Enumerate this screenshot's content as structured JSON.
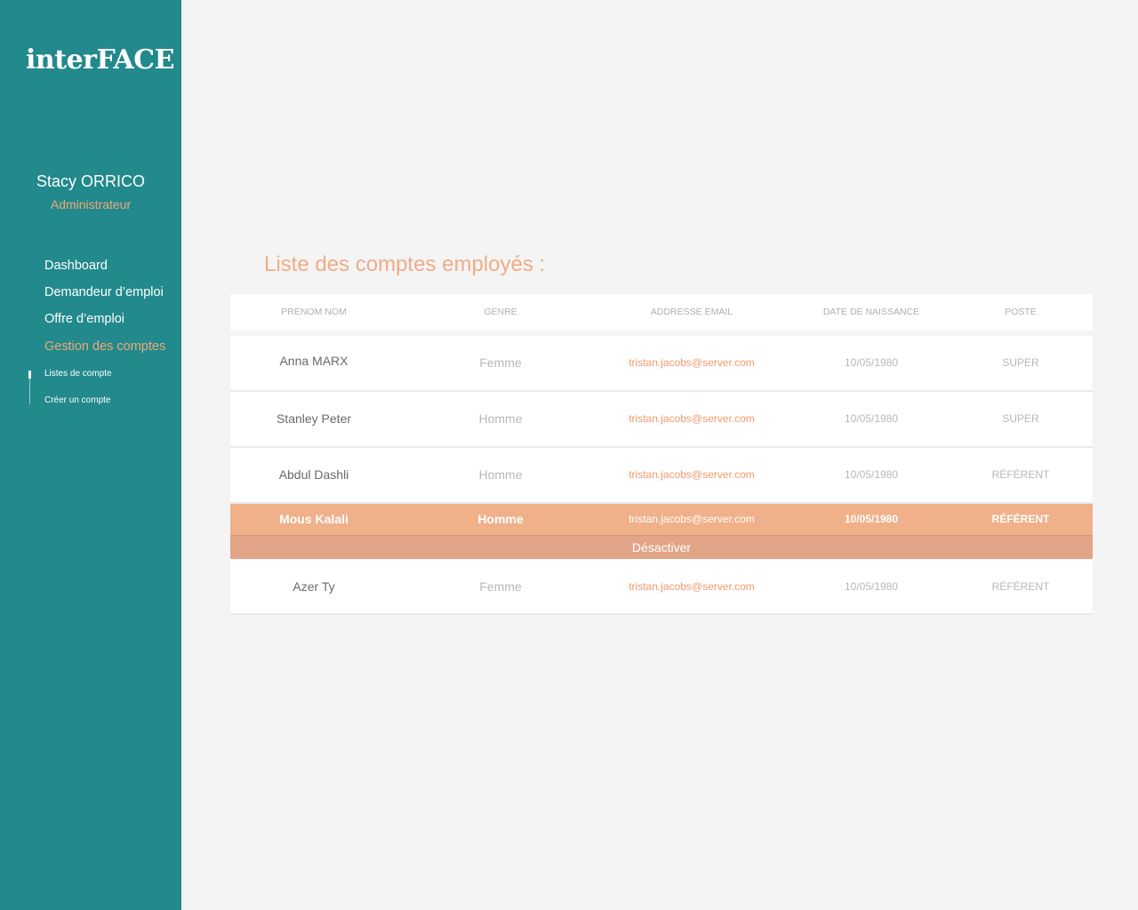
{
  "sidebar": {
    "logo": "interFACE",
    "user_name": "Stacy ORRICO",
    "user_role": "Administrateur",
    "nav": [
      {
        "label": "Dashboard"
      },
      {
        "label": "Demandeur d’emploi"
      },
      {
        "label": "Offre d’emploi"
      },
      {
        "label": "Gestion des comptes",
        "active": true
      }
    ],
    "subnav": [
      {
        "label": "Listes de compte",
        "active": true
      },
      {
        "label": "Créer un compte"
      }
    ]
  },
  "main": {
    "title": "Liste des comptes employés :",
    "columns": [
      "PRENOM NOM",
      "GENRE",
      "ADDRESSE EMAIL",
      "DATE DE NAISSANCE",
      "POSTE"
    ],
    "rows": [
      {
        "name": "Anna  MARX",
        "gender": "Femme",
        "email": "tristan.jacobs@server.com",
        "birthdate": "10/05/1980",
        "role": "SUPER"
      },
      {
        "name": "Stanley  Peter",
        "gender": "Homme",
        "email": "tristan.jacobs@server.com",
        "birthdate": "10/05/1980",
        "role": "SUPER"
      },
      {
        "name": "Abdul Dashli",
        "gender": "Homme",
        "email": "tristan.jacobs@server.com",
        "birthdate": "10/05/1980",
        "role": "RÉFÉRENT"
      },
      {
        "name": "Mous  Kalali",
        "gender": "Homme",
        "email": "tristan.jacobs@server.com",
        "birthdate": "10/05/1980",
        "role": "RÉFÉRENT",
        "selected": true
      },
      {
        "name": "Azer  Ty",
        "gender": "Femme",
        "email": "tristan.jacobs@server.com",
        "birthdate": "10/05/1980",
        "role": "RÉFÉRENT"
      }
    ],
    "deactivate_label": "Désactiver"
  },
  "colors": {
    "sidebar_bg": "#22898c",
    "accent": "#f0a878",
    "selected_row": "#f0b08a",
    "deactivate_bg": "#e3a587",
    "page_bg": "#f4f4f4"
  }
}
